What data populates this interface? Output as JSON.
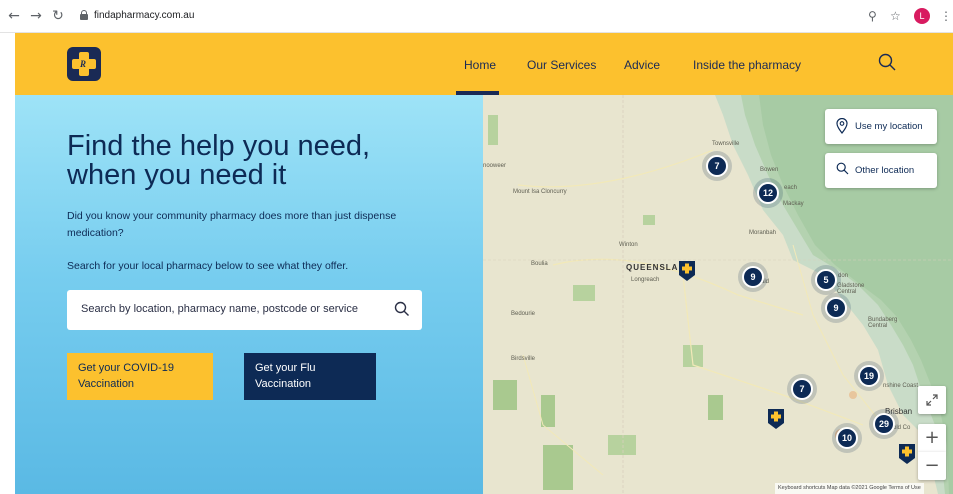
{
  "browser": {
    "url": "findapharmacy.com.au",
    "profile_initial": "L"
  },
  "header": {
    "nav": [
      {
        "label": "Home",
        "active": true
      },
      {
        "label": "Our Services"
      },
      {
        "label": "Advice"
      },
      {
        "label": "Inside the pharmacy"
      }
    ],
    "brand_color": "#fcc12e",
    "navy": "#0d2a55"
  },
  "hero": {
    "title": "Find the help you need, when you need it",
    "intro": "Did you know your community pharmacy does more than just dispense medication?",
    "search_prompt": "Search for your local pharmacy below to see what they offer.",
    "search_placeholder": "Search by location, pharmacy name, postcode or service",
    "btn_covid": "Get your COVID-19 Vaccination",
    "btn_flu": "Get your Flu Vaccination"
  },
  "map": {
    "use_location": "Use my location",
    "other_location": "Other location",
    "labels": {
      "townsville": "Townsville",
      "bowen": "Bowen",
      "mackay": "Mackay",
      "beach": "each",
      "moranbah": "Moranbah",
      "mount_isa": "Mount Isa Cloncurry",
      "winton": "Winton",
      "boulia": "Boulia",
      "queensland": "QUEENSLA",
      "longreach": "Longreach",
      "bedourie": "Bedourie",
      "birdsville": "Birdsville",
      "rockhampton": "don",
      "gladstone": "Gladstone Central",
      "emerald": "ald",
      "bundaberg": "Bundaberg Central",
      "sunshine": "nshine Coast",
      "brisbane": "Brisban",
      "goldcoast": "old Co",
      "nooweer": "nooweer"
    },
    "clusters": [
      "7",
      "12",
      "9",
      "5",
      "9",
      "7",
      "19",
      "29",
      "10"
    ],
    "attribution": "Keyboard shortcuts   Map data ©2021 Google   Terms of Use",
    "zoom_in": "+",
    "zoom_out": "−"
  }
}
